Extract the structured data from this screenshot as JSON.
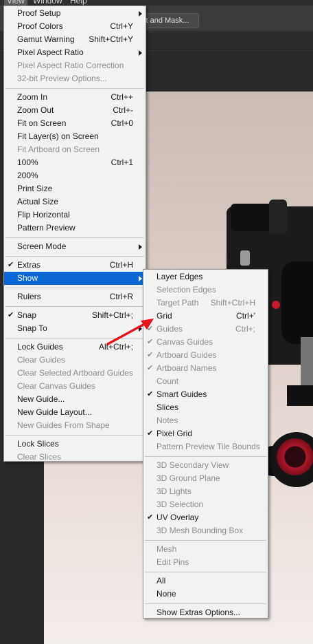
{
  "menubar": {
    "items": [
      "View",
      "Window",
      "Help"
    ]
  },
  "options_bar": {
    "select_and_mask_label": "ct and Mask..."
  },
  "view_menu": {
    "items": [
      {
        "label": "Proof Setup",
        "shortcut": "",
        "submenu": true,
        "checked": false,
        "disabled": false,
        "highlighted": false
      },
      {
        "label": "Proof Colors",
        "shortcut": "Ctrl+Y",
        "submenu": false,
        "checked": false,
        "disabled": false,
        "highlighted": false
      },
      {
        "label": "Gamut Warning",
        "shortcut": "Shift+Ctrl+Y",
        "submenu": false,
        "checked": false,
        "disabled": false,
        "highlighted": false
      },
      {
        "label": "Pixel Aspect Ratio",
        "shortcut": "",
        "submenu": true,
        "checked": false,
        "disabled": false,
        "highlighted": false
      },
      {
        "label": "Pixel Aspect Ratio Correction",
        "shortcut": "",
        "submenu": false,
        "checked": false,
        "disabled": true,
        "highlighted": false
      },
      {
        "label": "32-bit Preview Options...",
        "shortcut": "",
        "submenu": false,
        "checked": false,
        "disabled": true,
        "highlighted": false
      },
      {
        "separator": true
      },
      {
        "label": "Zoom In",
        "shortcut": "Ctrl++",
        "submenu": false,
        "checked": false,
        "disabled": false,
        "highlighted": false
      },
      {
        "label": "Zoom Out",
        "shortcut": "Ctrl+-",
        "submenu": false,
        "checked": false,
        "disabled": false,
        "highlighted": false
      },
      {
        "label": "Fit on Screen",
        "shortcut": "Ctrl+0",
        "submenu": false,
        "checked": false,
        "disabled": false,
        "highlighted": false
      },
      {
        "label": "Fit Layer(s) on Screen",
        "shortcut": "",
        "submenu": false,
        "checked": false,
        "disabled": false,
        "highlighted": false
      },
      {
        "label": "Fit Artboard on Screen",
        "shortcut": "",
        "submenu": false,
        "checked": false,
        "disabled": true,
        "highlighted": false
      },
      {
        "label": "100%",
        "shortcut": "Ctrl+1",
        "submenu": false,
        "checked": false,
        "disabled": false,
        "highlighted": false
      },
      {
        "label": "200%",
        "shortcut": "",
        "submenu": false,
        "checked": false,
        "disabled": false,
        "highlighted": false
      },
      {
        "label": "Print Size",
        "shortcut": "",
        "submenu": false,
        "checked": false,
        "disabled": false,
        "highlighted": false
      },
      {
        "label": "Actual Size",
        "shortcut": "",
        "submenu": false,
        "checked": false,
        "disabled": false,
        "highlighted": false
      },
      {
        "label": "Flip Horizontal",
        "shortcut": "",
        "submenu": false,
        "checked": false,
        "disabled": false,
        "highlighted": false
      },
      {
        "label": "Pattern Preview",
        "shortcut": "",
        "submenu": false,
        "checked": false,
        "disabled": false,
        "highlighted": false
      },
      {
        "separator": true
      },
      {
        "label": "Screen Mode",
        "shortcut": "",
        "submenu": true,
        "checked": false,
        "disabled": false,
        "highlighted": false
      },
      {
        "separator": true
      },
      {
        "label": "Extras",
        "shortcut": "Ctrl+H",
        "submenu": false,
        "checked": true,
        "disabled": false,
        "highlighted": false
      },
      {
        "label": "Show",
        "shortcut": "",
        "submenu": true,
        "checked": false,
        "disabled": false,
        "highlighted": true
      },
      {
        "separator": true
      },
      {
        "label": "Rulers",
        "shortcut": "Ctrl+R",
        "submenu": false,
        "checked": false,
        "disabled": false,
        "highlighted": false
      },
      {
        "separator": true
      },
      {
        "label": "Snap",
        "shortcut": "Shift+Ctrl+;",
        "submenu": false,
        "checked": true,
        "disabled": false,
        "highlighted": false
      },
      {
        "label": "Snap To",
        "shortcut": "",
        "submenu": true,
        "checked": false,
        "disabled": false,
        "highlighted": false
      },
      {
        "separator": true
      },
      {
        "label": "Lock Guides",
        "shortcut": "Alt+Ctrl+;",
        "submenu": false,
        "checked": false,
        "disabled": false,
        "highlighted": false
      },
      {
        "label": "Clear Guides",
        "shortcut": "",
        "submenu": false,
        "checked": false,
        "disabled": true,
        "highlighted": false
      },
      {
        "label": "Clear Selected Artboard Guides",
        "shortcut": "",
        "submenu": false,
        "checked": false,
        "disabled": true,
        "highlighted": false
      },
      {
        "label": "Clear Canvas Guides",
        "shortcut": "",
        "submenu": false,
        "checked": false,
        "disabled": true,
        "highlighted": false
      },
      {
        "label": "New Guide...",
        "shortcut": "",
        "submenu": false,
        "checked": false,
        "disabled": false,
        "highlighted": false
      },
      {
        "label": "New Guide Layout...",
        "shortcut": "",
        "submenu": false,
        "checked": false,
        "disabled": false,
        "highlighted": false
      },
      {
        "label": "New Guides From Shape",
        "shortcut": "",
        "submenu": false,
        "checked": false,
        "disabled": true,
        "highlighted": false
      },
      {
        "separator": true
      },
      {
        "label": "Lock Slices",
        "shortcut": "",
        "submenu": false,
        "checked": false,
        "disabled": false,
        "highlighted": false
      },
      {
        "label": "Clear Slices",
        "shortcut": "",
        "submenu": false,
        "checked": false,
        "disabled": true,
        "highlighted": false
      }
    ]
  },
  "show_menu": {
    "items": [
      {
        "label": "Layer Edges",
        "shortcut": "",
        "checked": false,
        "disabled": false
      },
      {
        "label": "Selection Edges",
        "shortcut": "",
        "checked": false,
        "disabled": true
      },
      {
        "label": "Target Path",
        "shortcut": "Shift+Ctrl+H",
        "checked": false,
        "disabled": true
      },
      {
        "label": "Grid",
        "shortcut": "Ctrl+'",
        "checked": false,
        "disabled": false
      },
      {
        "label": "Guides",
        "shortcut": "Ctrl+;",
        "checked": true,
        "disabled": true
      },
      {
        "label": "Canvas Guides",
        "shortcut": "",
        "checked": true,
        "disabled": true
      },
      {
        "label": "Artboard Guides",
        "shortcut": "",
        "checked": true,
        "disabled": true
      },
      {
        "label": "Artboard Names",
        "shortcut": "",
        "checked": true,
        "disabled": true
      },
      {
        "label": "Count",
        "shortcut": "",
        "checked": false,
        "disabled": true
      },
      {
        "label": "Smart Guides",
        "shortcut": "",
        "checked": true,
        "disabled": false
      },
      {
        "label": "Slices",
        "shortcut": "",
        "checked": false,
        "disabled": false
      },
      {
        "label": "Notes",
        "shortcut": "",
        "checked": false,
        "disabled": true
      },
      {
        "label": "Pixel Grid",
        "shortcut": "",
        "checked": true,
        "disabled": false
      },
      {
        "label": "Pattern Preview Tile Bounds",
        "shortcut": "",
        "checked": false,
        "disabled": true
      },
      {
        "separator": true
      },
      {
        "label": "3D Secondary View",
        "shortcut": "",
        "checked": false,
        "disabled": true
      },
      {
        "label": "3D Ground Plane",
        "shortcut": "",
        "checked": false,
        "disabled": true
      },
      {
        "label": "3D Lights",
        "shortcut": "",
        "checked": false,
        "disabled": true
      },
      {
        "label": "3D Selection",
        "shortcut": "",
        "checked": false,
        "disabled": true
      },
      {
        "label": "UV Overlay",
        "shortcut": "",
        "checked": true,
        "disabled": false
      },
      {
        "label": "3D Mesh Bounding Box",
        "shortcut": "",
        "checked": false,
        "disabled": true
      },
      {
        "separator": true
      },
      {
        "label": "Mesh",
        "shortcut": "",
        "checked": false,
        "disabled": true
      },
      {
        "label": "Edit Pins",
        "shortcut": "",
        "checked": false,
        "disabled": true
      },
      {
        "separator": true
      },
      {
        "label": "All",
        "shortcut": "",
        "checked": false,
        "disabled": false
      },
      {
        "label": "None",
        "shortcut": "",
        "checked": false,
        "disabled": false
      },
      {
        "separator": true
      },
      {
        "label": "Show Extras Options...",
        "shortcut": "",
        "checked": false,
        "disabled": false
      }
    ]
  },
  "icons": {
    "check": "checkmark-icon",
    "submenu": "submenu-arrow-icon",
    "annotation": "red-arrow-annotation"
  },
  "colors": {
    "highlight": "#0a67d5",
    "menu_bg": "#f2f2f2",
    "annotation": "#e3141c"
  }
}
